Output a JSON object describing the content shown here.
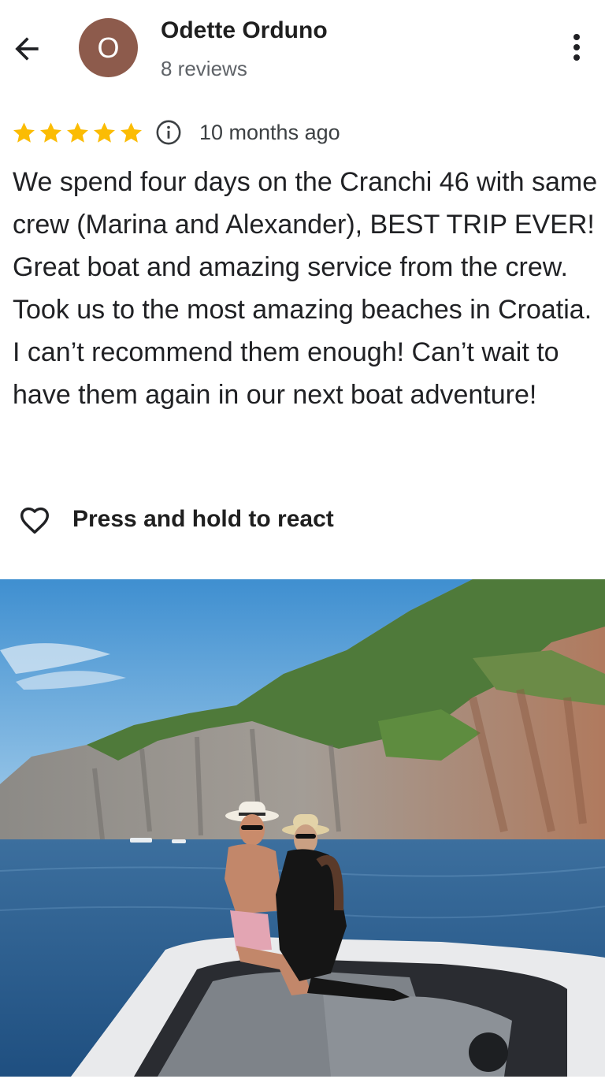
{
  "header": {
    "avatar_letter": "O",
    "user_name": "Odette Orduno",
    "review_count": "8 reviews"
  },
  "rating": {
    "stars": 5,
    "time_ago": "10 months ago"
  },
  "review": {
    "text": "We spend four days on the Cranchi 46 with same crew (Marina and Alexander), BEST TRIP EVER! Great boat and amazing service from the crew. Took us to the most amazing beaches in Croatia. I can’t recommend them enough! Can’t wait to have them again in our next boat adventure!"
  },
  "reaction": {
    "label": "Press and hold to react"
  },
  "colors": {
    "avatar_bg": "#8d5b4c",
    "star": "#fbbc04"
  },
  "icons": [
    "back-arrow-icon",
    "more-vert-icon",
    "star-icon",
    "info-icon",
    "heart-outline-icon"
  ]
}
